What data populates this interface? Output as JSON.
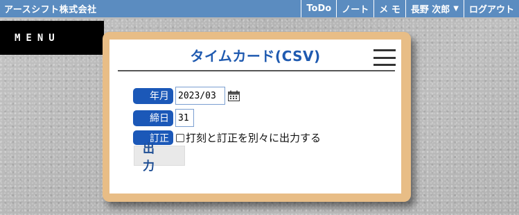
{
  "header": {
    "company": "アースシフト株式会社",
    "nav": [
      {
        "label": "ToDo"
      },
      {
        "label": "ノート"
      },
      {
        "label": "メ モ"
      },
      {
        "label": "長野 次郎"
      },
      {
        "label": "ログアウト"
      }
    ]
  },
  "menu": {
    "label": "MENU"
  },
  "card": {
    "title": "タイムカード(CSV)",
    "fields": {
      "year_month": {
        "label": "年月",
        "value": "2023/03"
      },
      "closing_day": {
        "label": "締日",
        "value": "31"
      },
      "correction": {
        "label": "訂正",
        "checkbox_label": "打刻と訂正を別々に出力する",
        "checked": false
      }
    },
    "output_button": "出 力"
  },
  "colors": {
    "topbar": "#5b8cc0",
    "label_bg": "#1b58b8",
    "title": "#1f5ab0",
    "frame": "#e8bd86"
  },
  "icons": [
    "calendar-icon",
    "hamburger-menu-icon",
    "caret-down-icon"
  ]
}
